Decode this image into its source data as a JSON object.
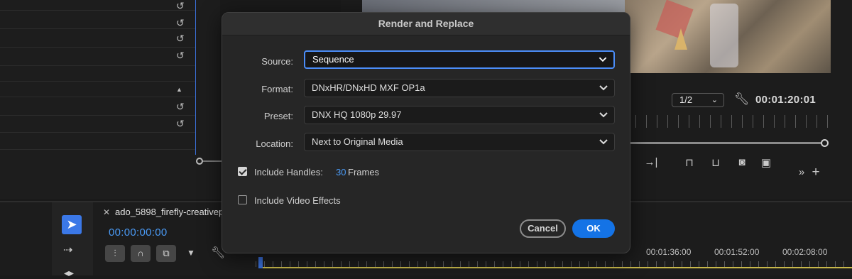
{
  "background": {
    "monitor": {
      "zoom_level": "1/2",
      "timecode": "00:01:20:01"
    },
    "sequence": {
      "tab_title": "ado_5898_firefly-creativep",
      "timecode": "00:00:00:00",
      "ruler_times": [
        "00:01:36:00",
        "00:01:52:00",
        "00:02:08:00"
      ]
    }
  },
  "dialog": {
    "title": "Render and Replace",
    "fields": {
      "source": {
        "label": "Source:",
        "value": "Sequence"
      },
      "format": {
        "label": "Format:",
        "value": "DNxHR/DNxHD MXF OP1a"
      },
      "preset": {
        "label": "Preset:",
        "value": "DNX HQ 1080p 29.97"
      },
      "location": {
        "label": "Location:",
        "value": "Next to Original Media"
      }
    },
    "include_handles": {
      "label": "Include Handles:",
      "checked": true,
      "value": "30",
      "unit": "Frames"
    },
    "include_video_effects": {
      "label": "Include Video Effects",
      "checked": false
    },
    "buttons": {
      "cancel": "Cancel",
      "ok": "OK"
    }
  },
  "colors": {
    "accent": "#1473e6",
    "focus": "#4b8df8",
    "timecode_blue": "#4a9af5"
  }
}
